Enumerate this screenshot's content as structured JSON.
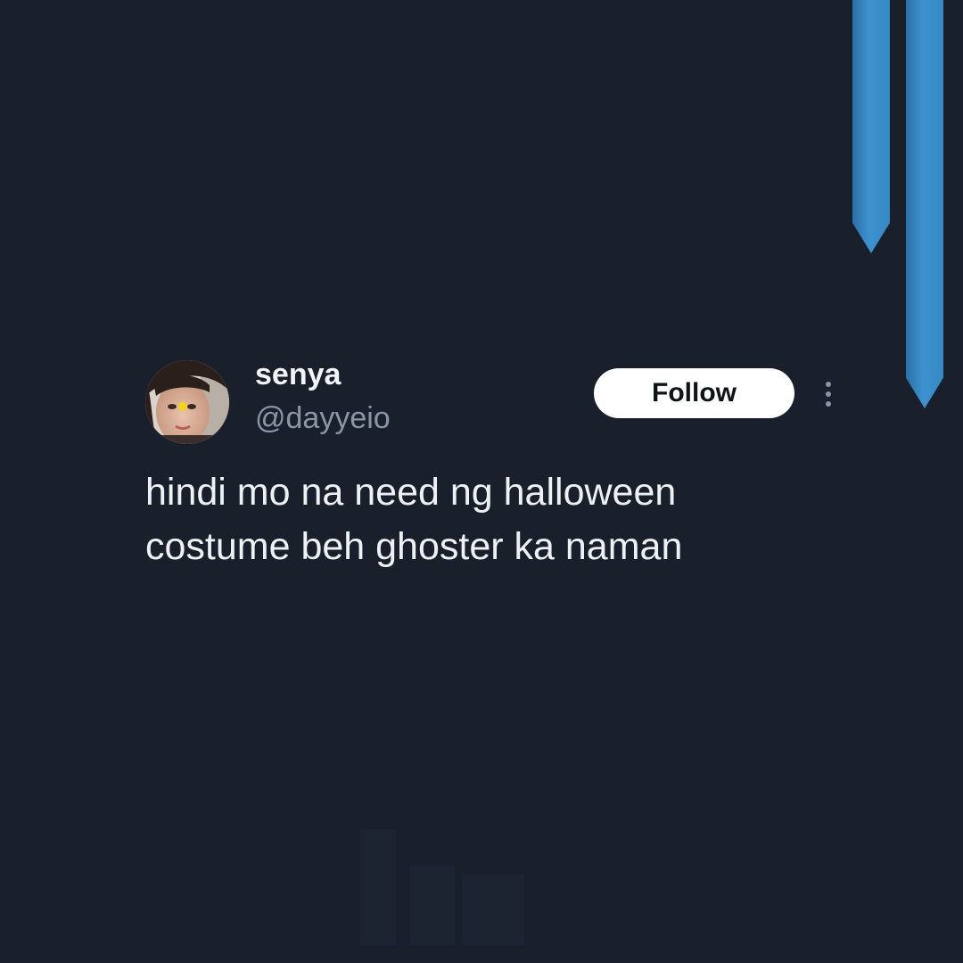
{
  "tweet": {
    "display_name": "senya",
    "handle": "@dayyeio",
    "follow_label": "Follow",
    "text_lines": [
      "hindi mo na need ng halloween",
      "costume beh ghoster ka naman"
    ],
    "avatar_icon": "profile-photo",
    "more_icon": "vertical-ellipsis-icon"
  },
  "colors": {
    "background": "#19202c",
    "ribbon": "#3488c3",
    "name": "#f2f4f7",
    "handle": "#8a96a3",
    "button_bg": "#ffffff",
    "button_text": "#0f1419"
  }
}
